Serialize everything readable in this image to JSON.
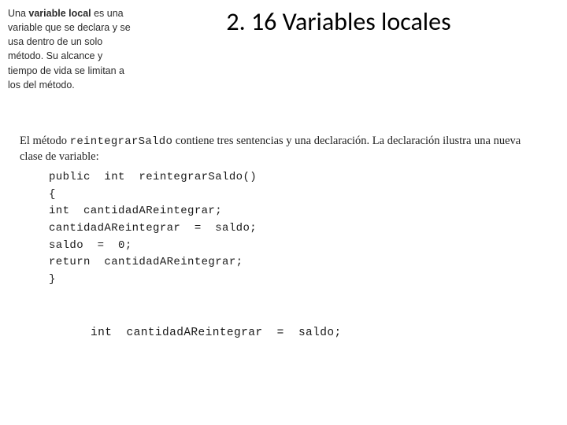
{
  "heading": "2. 16 Variables locales",
  "sidebar": {
    "prefix": "Una ",
    "bold": "variable local",
    "rest": " es una variable que se declara y se usa dentro de un solo método. Su alcance y tiempo de vida se limitan a los del método."
  },
  "paragraph": {
    "p1": "El método ",
    "mono": "reintegrarSaldo",
    "p2": " contiene tres sentencias y una declaración. La declaración ilustra una nueva clase de variable:"
  },
  "code": {
    "l1": "public  int  reintegrarSaldo()",
    "l2": "{",
    "l3": "int  cantidadAReintegrar;",
    "l4": "cantidadAReintegrar  =  saldo;",
    "l5": "saldo  =  0;",
    "l6": "return  cantidadAReintegrar;",
    "l7": "}"
  },
  "snippet": "int  cantidadAReintegrar  =  saldo;"
}
